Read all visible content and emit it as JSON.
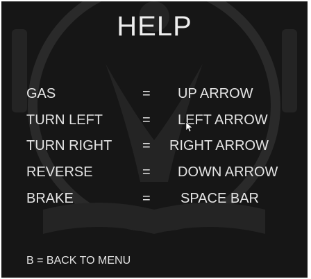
{
  "title": "HELP",
  "controls": [
    {
      "action": "GAS",
      "separator": "=",
      "key": "UP ARROW"
    },
    {
      "action": "TURN LEFT",
      "separator": "=",
      "key": "LEFT ARROW"
    },
    {
      "action": "TURN RIGHT",
      "separator": "=",
      "key": "RIGHT ARROW"
    },
    {
      "action": "REVERSE",
      "separator": "=",
      "key": "DOWN ARROW"
    },
    {
      "action": "BRAKE",
      "separator": "=",
      "key": "SPACE BAR"
    }
  ],
  "footer": {
    "back_label": "B = BACK TO MENU"
  },
  "colors": {
    "background": "#161616",
    "text": "#e9e9e9"
  },
  "icons": {
    "watermark": "university-logo-watermark",
    "cursor": "mouse-pointer-icon"
  }
}
